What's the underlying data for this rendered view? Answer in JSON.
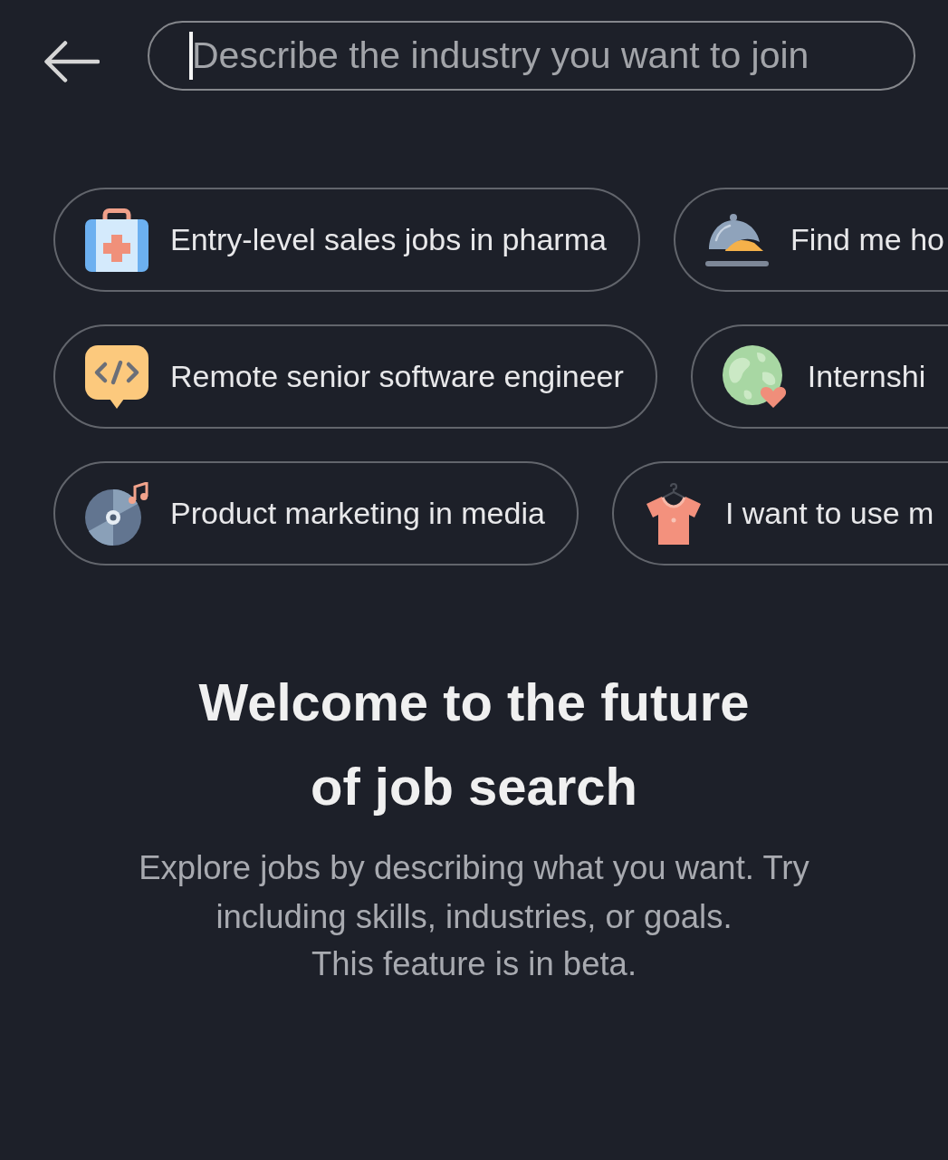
{
  "search": {
    "placeholder": "Describe the industry you want to join",
    "focused": true
  },
  "suggestion_rows": [
    {
      "chips": [
        {
          "label": "Entry-level sales jobs in pharma"
        },
        {
          "label": "Find me ho"
        }
      ]
    },
    {
      "chips": [
        {
          "label": "Remote senior software engineer"
        },
        {
          "label": "Internshi"
        }
      ]
    },
    {
      "chips": [
        {
          "label": "Product marketing in media"
        },
        {
          "label": "I want to use m"
        }
      ]
    }
  ],
  "welcome": {
    "title": "Welcome to the future of job search",
    "description": "Explore jobs by describing what you want. Try including skills, industries, or goals.",
    "note": "This feature is in beta."
  }
}
